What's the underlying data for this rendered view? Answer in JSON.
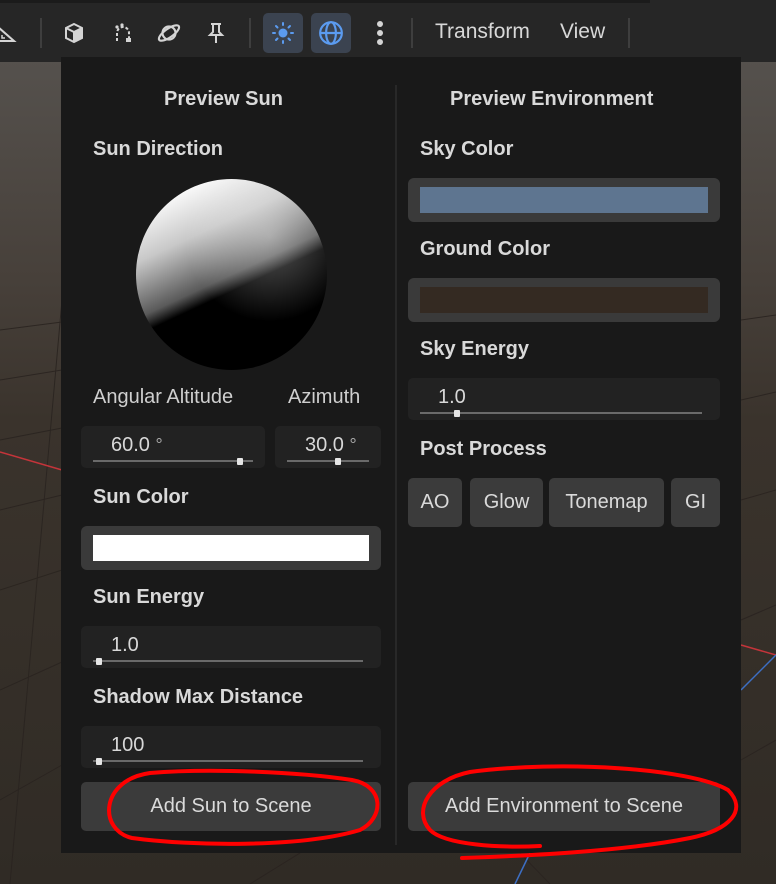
{
  "colors": {
    "accent": "#5b9bf0",
    "sky_color": "#5e7590",
    "ground_color": "#342a22",
    "sun_color": "#ffffff",
    "annotation": "#ff0000"
  },
  "toolbar": {
    "icons": [
      "ruler-icon",
      "cube-icon",
      "snap-icon",
      "planet-icon",
      "pin-icon",
      "sun-icon",
      "globe-icon",
      "more-icon"
    ],
    "transform_label": "Transform",
    "view_label": "View"
  },
  "sun": {
    "heading": "Preview Sun",
    "direction_label": "Sun Direction",
    "altitude_label": "Angular Altitude",
    "azimuth_label": "Azimuth",
    "altitude_value": "60.0",
    "altitude_unit": "°",
    "azimuth_value": "30.0",
    "azimuth_unit": "°",
    "altitude_level": 0.92,
    "azimuth_level": 0.62,
    "color_label": "Sun Color",
    "energy_label": "Sun Energy",
    "energy_value": "1.0",
    "shadow_label": "Shadow Max Distance",
    "shadow_value": "100",
    "add_button": "Add Sun to Scene"
  },
  "environment": {
    "heading": "Preview Environment",
    "sky_color_label": "Sky Color",
    "ground_color_label": "Ground Color",
    "sky_energy_label": "Sky Energy",
    "sky_energy_value": "1.0",
    "sky_energy_level": 0.13,
    "post_process_label": "Post Process",
    "post_process_buttons": [
      "AO",
      "Glow",
      "Tonemap",
      "GI"
    ],
    "add_button": "Add Environment to Scene"
  }
}
